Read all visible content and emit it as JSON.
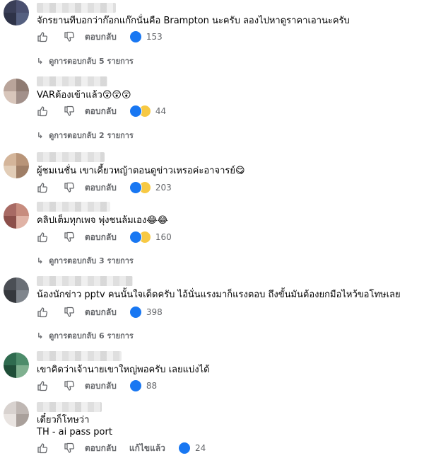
{
  "comments": [
    {
      "text": "จักรยานทีบอกว่าก๊อกแก๊กนั่นคือ Brampton นะครับ ลองไปหาดูราคาเอานะครับ",
      "reply_label": "ตอบกลับ",
      "reactions": [
        "like"
      ],
      "reaction_count": "153",
      "view_replies": "ดูการตอบกลับ 5 รายการ",
      "avatar_colors": [
        "#3a3f58",
        "#4a5070",
        "#2e3348",
        "#556080"
      ]
    },
    {
      "text": "VARต้องเข้าแล้ว😲😲😲",
      "reply_label": "ตอบกลับ",
      "reactions": [
        "like",
        "haha"
      ],
      "reaction_count": "44",
      "view_replies": "ดูการตอบกลับ 2 รายการ",
      "avatar_colors": [
        "#b9a49a",
        "#8f7b72",
        "#d8c6bb",
        "#a2908a"
      ]
    },
    {
      "text": "ผู้ชมเนชั่น เขาเคี้ยวหญ้าตอนดูข่าวเหรอค่ะอาจารย์😋",
      "reply_label": "ตอบกลับ",
      "reactions": [
        "like",
        "haha"
      ],
      "reaction_count": "203",
      "view_replies": "",
      "avatar_colors": [
        "#d4b59a",
        "#b89478",
        "#e2cdb7",
        "#9f7e66"
      ]
    },
    {
      "text": "คลิปเต็มทุกเพจ พุ่งชนล้มเอง😂😂",
      "reply_label": "ตอบกลับ",
      "reactions": [
        "like",
        "haha"
      ],
      "reaction_count": "160",
      "view_replies": "ดูการตอบกลับ 3 รายการ",
      "avatar_colors": [
        "#a86a64",
        "#c78c7e",
        "#8c4f4a",
        "#e0b3a6"
      ]
    },
    {
      "text": "น้องนักข่าว pptv คนนั้นใจเด็ดครับ ไอ้นั่นแรงมาก็แรงตอบ ถึงขั้นมันต้องยกมือไหว้ขอโทษเลย",
      "reply_label": "ตอบกลับ",
      "reactions": [
        "like"
      ],
      "reaction_count": "398",
      "view_replies": "ดูการตอบกลับ 6 รายการ",
      "avatar_colors": [
        "#4b4f55",
        "#6a6f76",
        "#35383d",
        "#7f858c"
      ]
    },
    {
      "text": "เขาคิดว่าเจ้านายเขาใหญ่พอครับ เลยแบ่งได้",
      "reply_label": "ตอบกลับ",
      "reactions": [
        "like"
      ],
      "reaction_count": "88",
      "view_replies": "",
      "avatar_colors": [
        "#2f6b4f",
        "#4d8c6a",
        "#1f4e38",
        "#7fb08f"
      ]
    },
    {
      "text": "เดี๋ยวก็โทษว่า",
      "text2": "TH - ai pass port",
      "reply_label": "ตอบกลับ",
      "edited_label": "แก้ไขแล้ว",
      "reactions": [
        "like"
      ],
      "reaction_count": "24",
      "view_replies": "",
      "avatar_colors": [
        "#d8d2cf",
        "#bfb7b3",
        "#e9e4e1",
        "#a9a09b"
      ]
    }
  ],
  "icons": {
    "like": "thumbs-up-icon",
    "dislike": "thumbs-down-icon",
    "reply_arrow": "reply-arrow-icon"
  },
  "colors": {
    "secondary_text": "#65676b",
    "like_blue": "#1877f2",
    "haha_yellow": "#f7c944"
  }
}
